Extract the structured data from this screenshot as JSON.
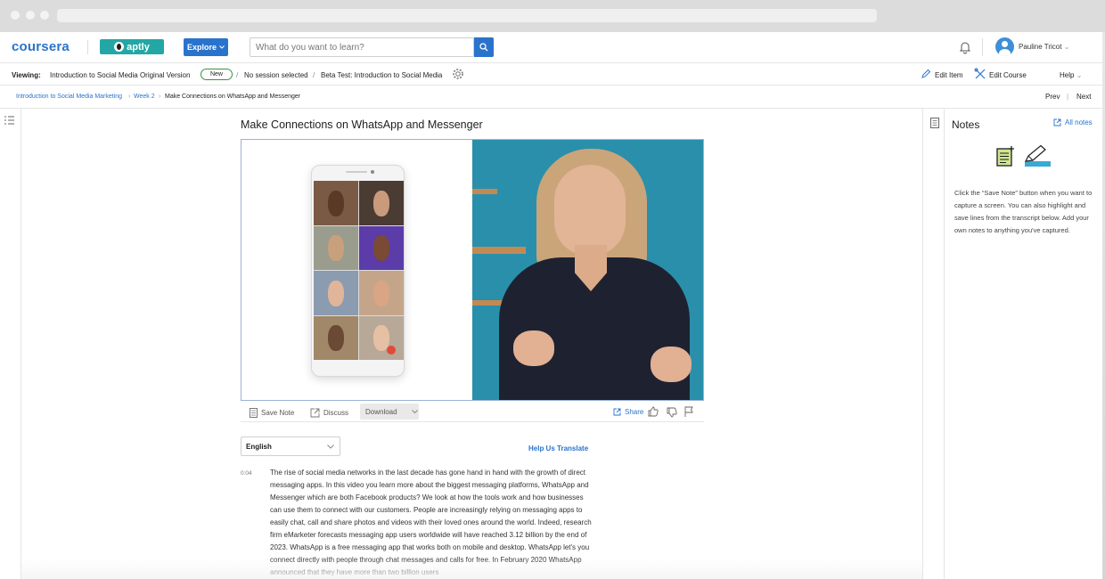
{
  "header": {
    "logo": "coursera",
    "partner_logo": "aptly",
    "explore_label": "Explore",
    "search_placeholder": "What do you want to learn?",
    "user_name": "Pauline Tricot"
  },
  "viewing_bar": {
    "label": "Viewing:",
    "course_version": "Introduction to Social Media Original Version",
    "badge": "New",
    "session": "No session selected",
    "beta": "Beta Test: Introduction to Social Media",
    "edit_item": "Edit Item",
    "edit_course": "Edit Course",
    "help": "Help"
  },
  "breadcrumb": {
    "course": "Introduction to Social Media Marketing",
    "week": "Week 2",
    "current": "Make Connections on WhatsApp and Messenger",
    "prev": "Prev",
    "next": "Next"
  },
  "lecture": {
    "title": "Make Connections on WhatsApp and Messenger"
  },
  "video_toolbar": {
    "save_note": "Save Note",
    "discuss": "Discuss",
    "download": "Download",
    "share": "Share"
  },
  "transcript": {
    "language": "English",
    "help_translate": "Help Us Translate",
    "timestamp": "0:04",
    "text": "The rise of social media networks in the last decade has gone hand in hand with the growth of direct messaging apps. In this video you learn more about the biggest messaging platforms, WhatsApp and Messenger which are both Facebook products? We look at how the tools work and how businesses can use them to connect with our customers. People are increasingly relying on messaging apps to easily chat, call and share photos and videos with their loved ones around the world. Indeed, research firm eMarketer forecasts messaging app users worldwide will have reached 3.12 billion by the end of 2023. WhatsApp is a free messaging app that works both on mobile and desktop. WhatsApp let's you connect directly with people through chat messages and calls for free. In February 2020 WhatsApp announced that they have more than two billion users"
  },
  "notes": {
    "title": "Notes",
    "all_notes": "All notes",
    "help_text": "Click the “Save Note” button when you want to capture a screen. You can also highlight and save lines from the transcript below. Add your own notes to anything you've captured."
  },
  "colors": {
    "brand_blue": "#2a73cc",
    "aptly_teal": "#23a7a5",
    "new_badge_border": "#3a8f4a",
    "video_backdrop": "#2a8fab"
  },
  "icons": [
    "search-icon",
    "bell-icon",
    "avatar-icon",
    "edit-icon",
    "tools-icon",
    "gear-icon",
    "list-icon",
    "document-icon",
    "external-link-icon",
    "thumbs-up-icon",
    "thumbs-down-icon",
    "flag-icon",
    "chevron-down-icon",
    "note-add-icon",
    "highlight-pen-icon"
  ]
}
